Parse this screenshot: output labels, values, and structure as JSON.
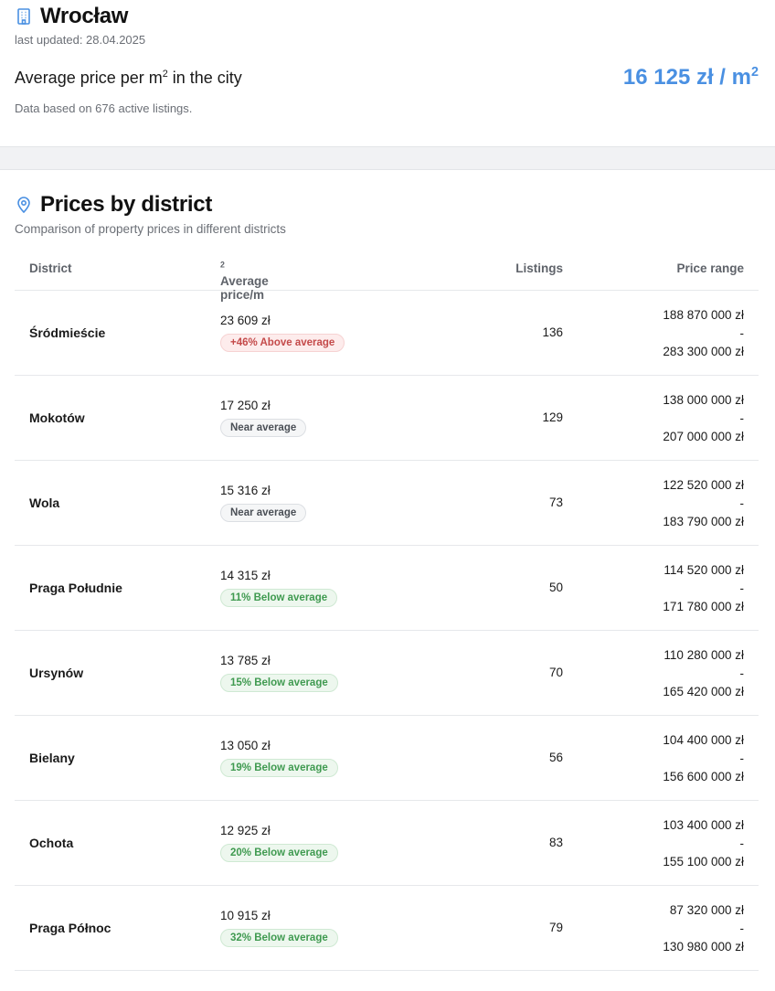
{
  "city": {
    "name": "Wrocław",
    "icon": "building-icon",
    "last_updated": "last updated: 28.04.2025",
    "avg_label": "Average price per m",
    "avg_label_sup": "2",
    "avg_label_suffix": " in the city",
    "avg_value": "16 125 zł / m",
    "avg_value_sup": "2",
    "listings_note": "Data based on 676 active listings.",
    "accent_color": "#4a90e2"
  },
  "districts_section": {
    "icon": "map-pin-icon",
    "title": "Prices by district",
    "subtitle": "Comparison of property prices in different districts",
    "columns": {
      "district": "District",
      "avg_price": "Average price/m",
      "avg_price_sup": "2",
      "listings": "Listings",
      "range": "Price range"
    },
    "rows": [
      {
        "district": "Śródmieście",
        "price": "23 609 zł",
        "badge": "+46% Above average",
        "badge_type": "above",
        "listings": "136",
        "range_min": "188 870 000 zł",
        "range_sep": "-",
        "range_max": "283 300 000 zł"
      },
      {
        "district": "Mokotów",
        "price": "17 250 zł",
        "badge": "Near average",
        "badge_type": "near",
        "listings": "129",
        "range_min": "138 000 000 zł",
        "range_sep": "-",
        "range_max": "207 000 000 zł"
      },
      {
        "district": "Wola",
        "price": "15 316 zł",
        "badge": "Near average",
        "badge_type": "near",
        "listings": "73",
        "range_min": "122 520 000 zł",
        "range_sep": "-",
        "range_max": "183 790 000 zł"
      },
      {
        "district": "Praga Południe",
        "price": "14 315 zł",
        "badge": "11% Below average",
        "badge_type": "below",
        "listings": "50",
        "range_min": "114 520 000 zł",
        "range_sep": "-",
        "range_max": "171 780 000 zł"
      },
      {
        "district": "Ursynów",
        "price": "13 785 zł",
        "badge": "15% Below average",
        "badge_type": "below",
        "listings": "70",
        "range_min": "110 280 000 zł",
        "range_sep": "-",
        "range_max": "165 420 000 zł"
      },
      {
        "district": "Bielany",
        "price": "13 050 zł",
        "badge": "19% Below average",
        "badge_type": "below",
        "listings": "56",
        "range_min": "104 400 000 zł",
        "range_sep": "-",
        "range_max": "156 600 000 zł"
      },
      {
        "district": "Ochota",
        "price": "12 925 zł",
        "badge": "20% Below average",
        "badge_type": "below",
        "listings": "83",
        "range_min": "103 400 000 zł",
        "range_sep": "-",
        "range_max": "155 100 000 zł"
      },
      {
        "district": "Praga Północ",
        "price": "10 915 zł",
        "badge": "32% Below average",
        "badge_type": "below",
        "listings": "79",
        "range_min": "87 320 000 zł",
        "range_sep": "-",
        "range_max": "130 980 000 zł"
      }
    ]
  }
}
